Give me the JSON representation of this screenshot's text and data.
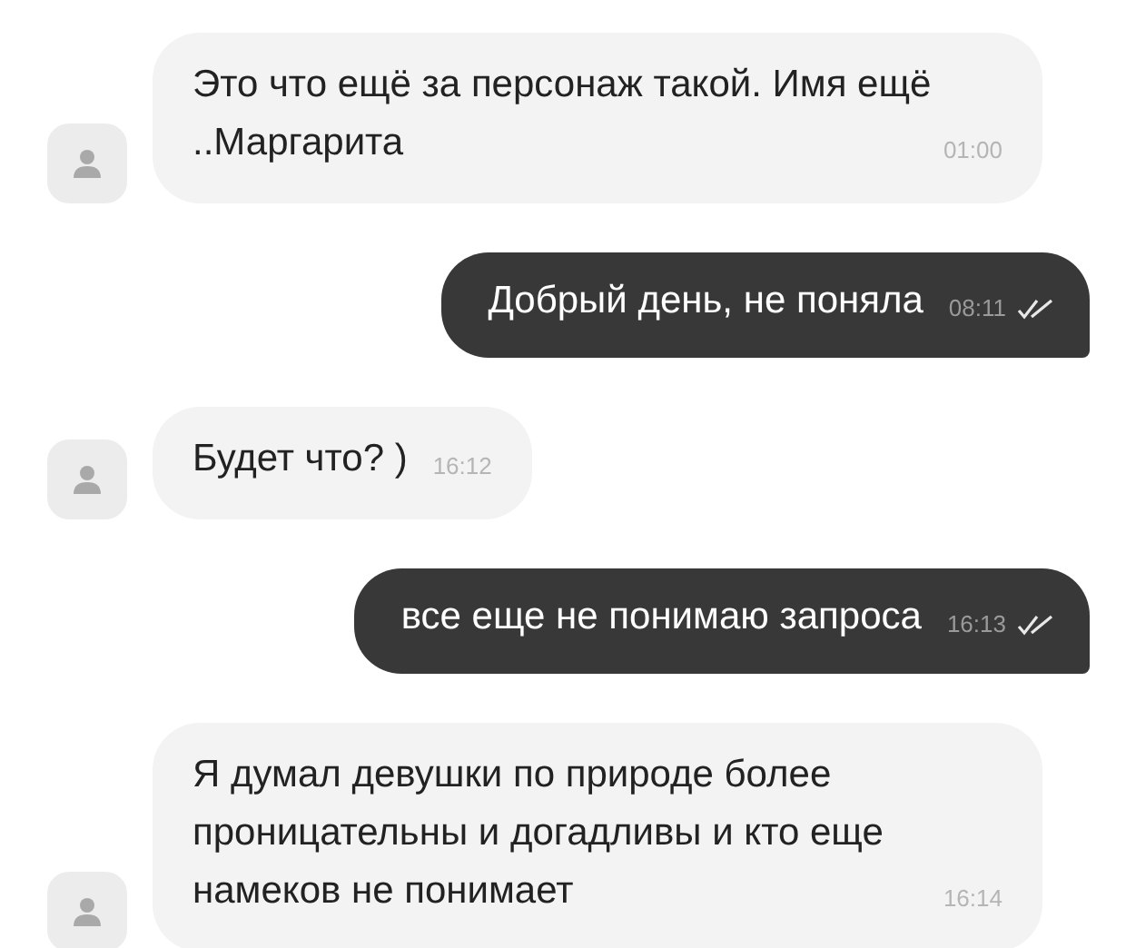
{
  "messages": [
    {
      "kind": "incoming",
      "text": "Это что ещё за персонаж такой. Имя ещё  ..Маргарита",
      "time": "01:00"
    },
    {
      "kind": "outgoing",
      "text": "Добрый день, не поняла",
      "time": "08:11",
      "read": true
    },
    {
      "kind": "incoming",
      "text": "Будет что? )",
      "time": "16:12"
    },
    {
      "kind": "outgoing",
      "text": "все еще не понимаю запроса",
      "time": "16:13",
      "read": true
    },
    {
      "kind": "incoming",
      "text": "Я думал девушки по природе более проницательны и догадливы и кто еще намеков не понимает",
      "time": "16:14"
    }
  ]
}
